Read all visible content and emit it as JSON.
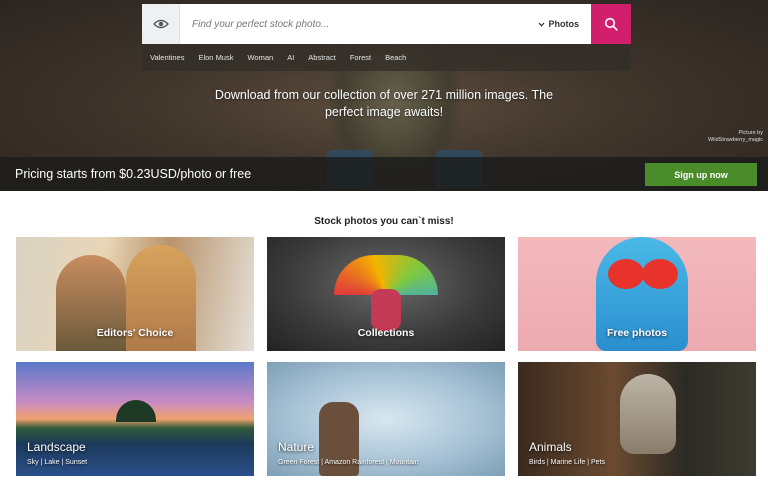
{
  "search": {
    "placeholder": "Find your perfect stock photo...",
    "type_label": "Photos"
  },
  "tags": [
    "Valentines",
    "Elon Musk",
    "Woman",
    "AI",
    "Abstract",
    "Forest",
    "Beach"
  ],
  "hero": {
    "headline_line1": "Download from our collection of over 271 million images. The",
    "headline_line2": "perfect image awaits!",
    "credit_line1": "Picture by",
    "credit_line2": "WildStrawberry_magic"
  },
  "pricing": {
    "text": "Pricing starts from $0.23USD/photo or free",
    "signup_label": "Sign up now"
  },
  "section_title": "Stock photos you can`t miss!",
  "cards": [
    {
      "label": "Editors' Choice"
    },
    {
      "label": "Collections"
    },
    {
      "label": "Free photos"
    },
    {
      "label": "Landscape",
      "sub": "Sky | Lake | Sunset"
    },
    {
      "label": "Nature",
      "sub": "Green Forest | Amazon Rainforest | Mountain"
    },
    {
      "label": "Animals",
      "sub": "Birds | Marine Life | Pets"
    }
  ],
  "colors": {
    "search_button": "#d11f6d",
    "signup_button": "#4a8c2a"
  },
  "icons": {
    "eye": "eye-icon",
    "search": "search-icon",
    "chevron": "chevron-down-icon"
  }
}
